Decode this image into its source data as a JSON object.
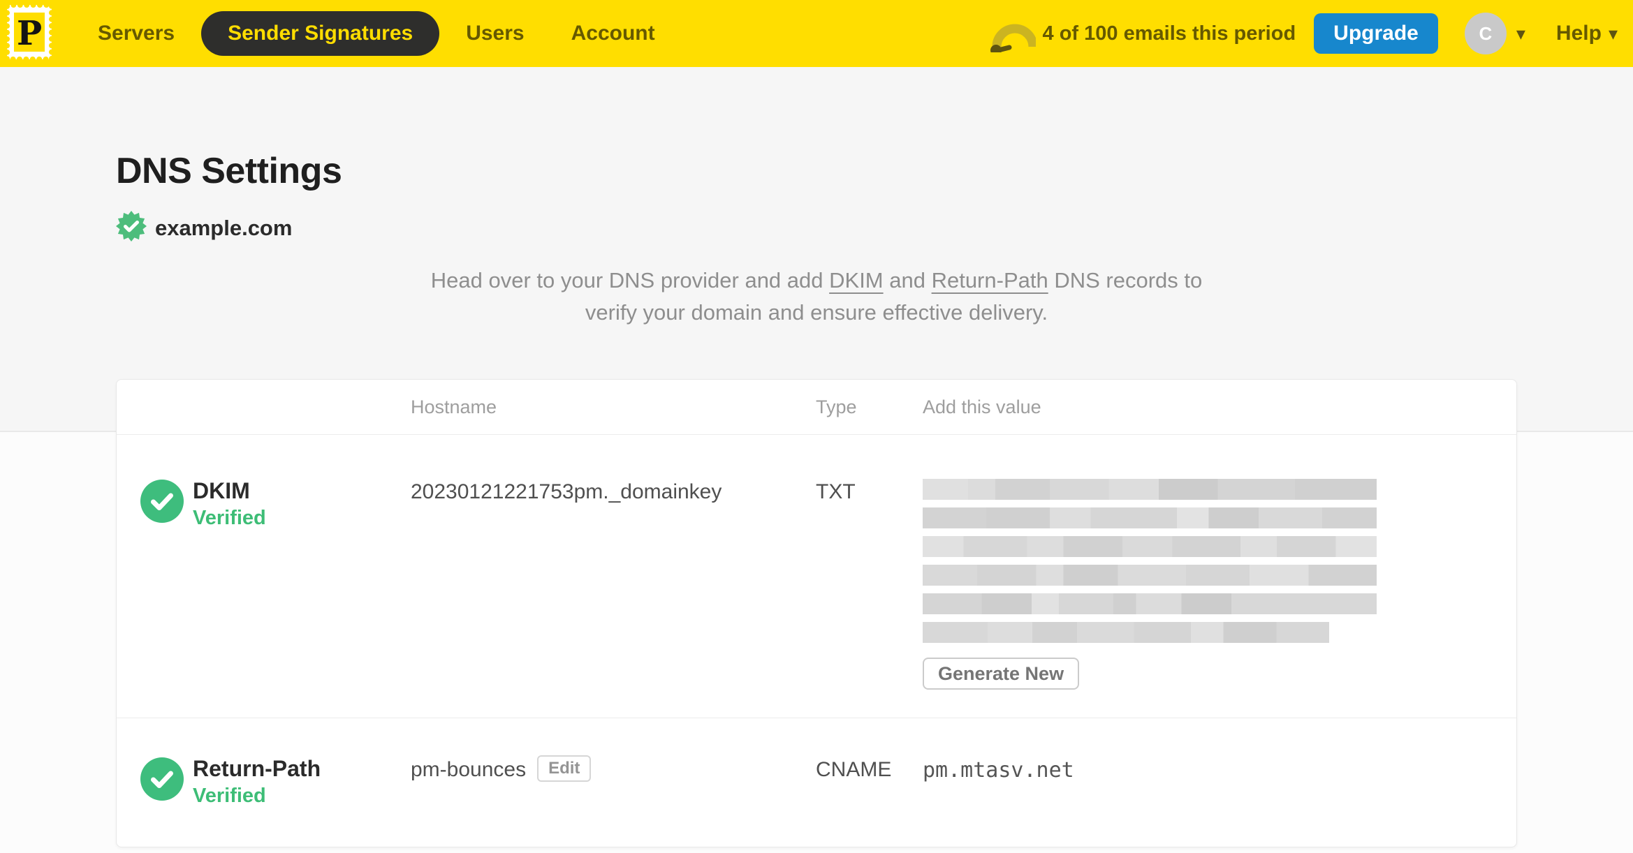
{
  "colors": {
    "brand_yellow": "#FFDE00",
    "nav_text_olive": "#665900",
    "active_pill_bg": "#2E2E2C",
    "upgrade_blue": "#1787CD",
    "verified_green": "#3DBD76",
    "page_bg": "#F6F6F6",
    "card_bg": "#FFFFFF"
  },
  "nav": {
    "brand_letter": "P",
    "items": [
      {
        "label": "Servers",
        "active": false
      },
      {
        "label": "Sender Signatures",
        "active": true
      },
      {
        "label": "Users",
        "active": false
      },
      {
        "label": "Account",
        "active": false
      }
    ],
    "usage": {
      "text": "4 of 100 emails this period",
      "icon": "gauge-icon"
    },
    "upgrade_label": "Upgrade",
    "avatar_initial": "C",
    "help_label": "Help"
  },
  "page": {
    "title": "DNS Settings",
    "domain": "example.com",
    "domain_verified_icon": "seal-check-icon",
    "description": {
      "part1": "Head over to your DNS provider and add ",
      "link_dkim": "DKIM",
      "part2": " and ",
      "link_return_path": "Return-Path",
      "part3": " DNS records to",
      "part4": "verify your domain and ensure effective delivery."
    }
  },
  "table": {
    "headers": [
      "Hostname",
      "Type",
      "Add this value"
    ],
    "rows": [
      {
        "name": "DKIM",
        "status": "Verified",
        "hostname": "20230121221753pm._domainkey",
        "type": "TXT",
        "value_redacted": true,
        "redacted_lines": 6,
        "action_label": "Generate New"
      },
      {
        "name": "Return-Path",
        "status": "Verified",
        "hostname": "pm-bounces",
        "hostname_action_label": "Edit",
        "type": "CNAME",
        "value": "pm.mtasv.net"
      }
    ]
  }
}
